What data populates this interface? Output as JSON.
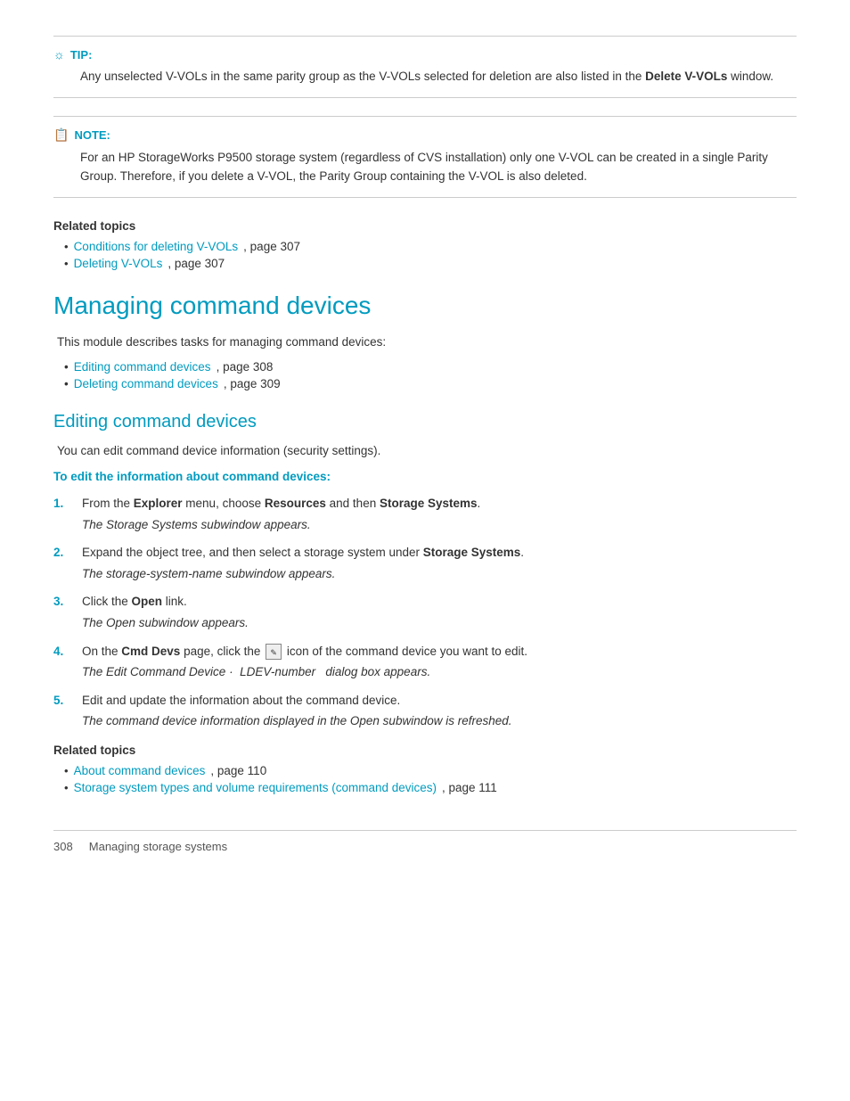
{
  "tip": {
    "label": "TIP:",
    "text_part1": "Any unselected V-VOLs in the same parity group as the V-VOLs selected for deletion are also listed in the ",
    "bold": "Delete V-VOLs",
    "text_part2": " window."
  },
  "note": {
    "label": "NOTE:",
    "text": "For an HP StorageWorks P9500 storage system (regardless of CVS installation) only one V-VOL can be created in a single Parity Group. Therefore, if you delete a V-VOL, the Parity Group containing the V-VOL is also deleted."
  },
  "related_topics_1": {
    "title": "Related topics",
    "items": [
      {
        "link": "Conditions for deleting V-VOLs",
        "suffix": ", page 307"
      },
      {
        "link": "Deleting V-VOLs",
        "suffix": ", page 307"
      }
    ]
  },
  "section_managing": {
    "title": "Managing command devices",
    "body": "This module describes tasks for managing command devices:",
    "links": [
      {
        "link": "Editing command devices",
        "suffix": ", page 308"
      },
      {
        "link": "Deleting command devices",
        "suffix": ", page 309"
      }
    ]
  },
  "section_editing": {
    "title": "Editing command devices",
    "body": "You can edit command device information (security settings).",
    "sub_heading": "To edit the information about command devices:",
    "steps": [
      {
        "num": "1.",
        "text_before": "From the ",
        "bold1": "Explorer",
        "text_mid1": " menu, choose ",
        "bold2": "Resources",
        "text_mid2": " and then ",
        "bold3": "Storage Systems",
        "text_after": ".",
        "sub": "The Storage Systems subwindow appears."
      },
      {
        "num": "2.",
        "text_before": "Expand the object tree, and then select a storage system under ",
        "bold1": "Storage Systems",
        "text_after": ".",
        "sub": "The storage-system-name subwindow appears.",
        "sub_italic": true
      },
      {
        "num": "3.",
        "text_before": "Click the ",
        "bold1": "Open",
        "text_after": " link.",
        "sub": "The Open subwindow appears."
      },
      {
        "num": "4.",
        "text_before": "On the ",
        "bold1": "Cmd Devs",
        "text_mid1": " page, click the ",
        "icon": true,
        "text_mid2": " icon of the command device you want to edit.",
        "sub": "The Edit Command Device ·  LDEV-number  dialog box appears.",
        "sub_italic_ldev": true
      },
      {
        "num": "5.",
        "text_before": "Edit and update the information about the command device.",
        "sub": "The command device information displayed in the Open subwindow is refreshed."
      }
    ]
  },
  "related_topics_2": {
    "title": "Related topics",
    "items": [
      {
        "link": "About command devices",
        "suffix": ", page 110"
      },
      {
        "link": "Storage system types and volume requirements (command devices)",
        "suffix": ", page 111"
      }
    ]
  },
  "footer": {
    "page_num": "308",
    "text": "Managing storage systems"
  }
}
